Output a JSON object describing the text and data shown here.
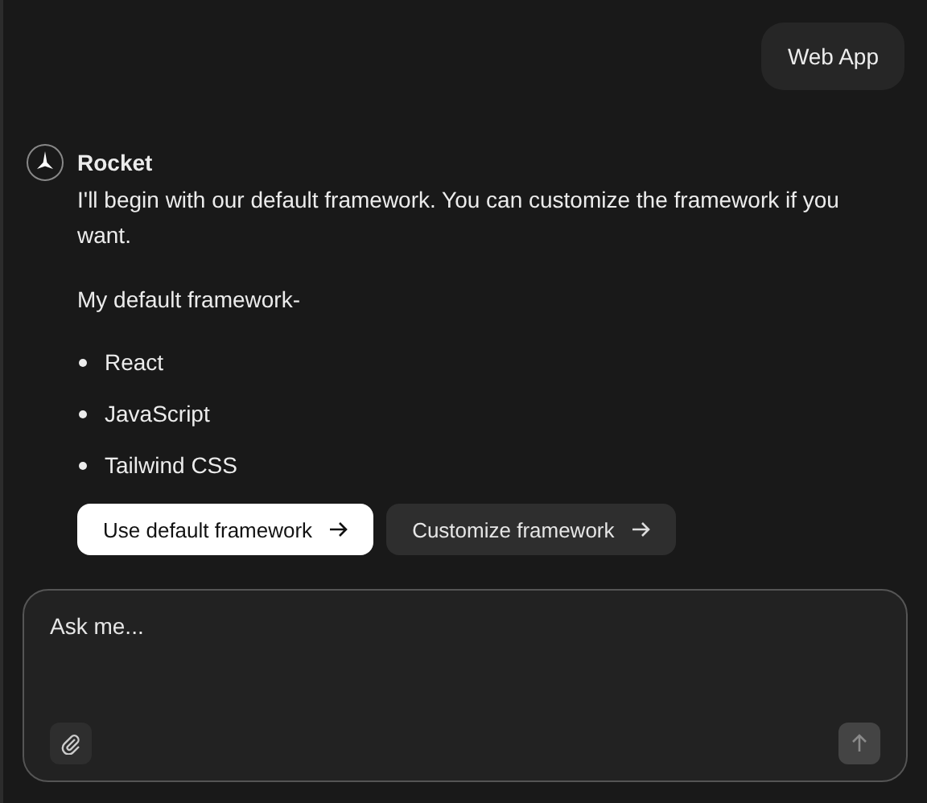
{
  "user_message": {
    "text": "Web App"
  },
  "assistant_message": {
    "name": "Rocket",
    "paragraphs": [
      "I'll begin with our default framework. You can customize the framework if you want.",
      "My default framework-"
    ],
    "list_items": [
      "React",
      "JavaScript",
      "Tailwind CSS"
    ],
    "actions": [
      {
        "label": "Use default framework",
        "kind": "primary"
      },
      {
        "label": "Customize framework",
        "kind": "secondary"
      }
    ]
  },
  "composer": {
    "placeholder": "Ask me...",
    "send_disabled": true
  }
}
